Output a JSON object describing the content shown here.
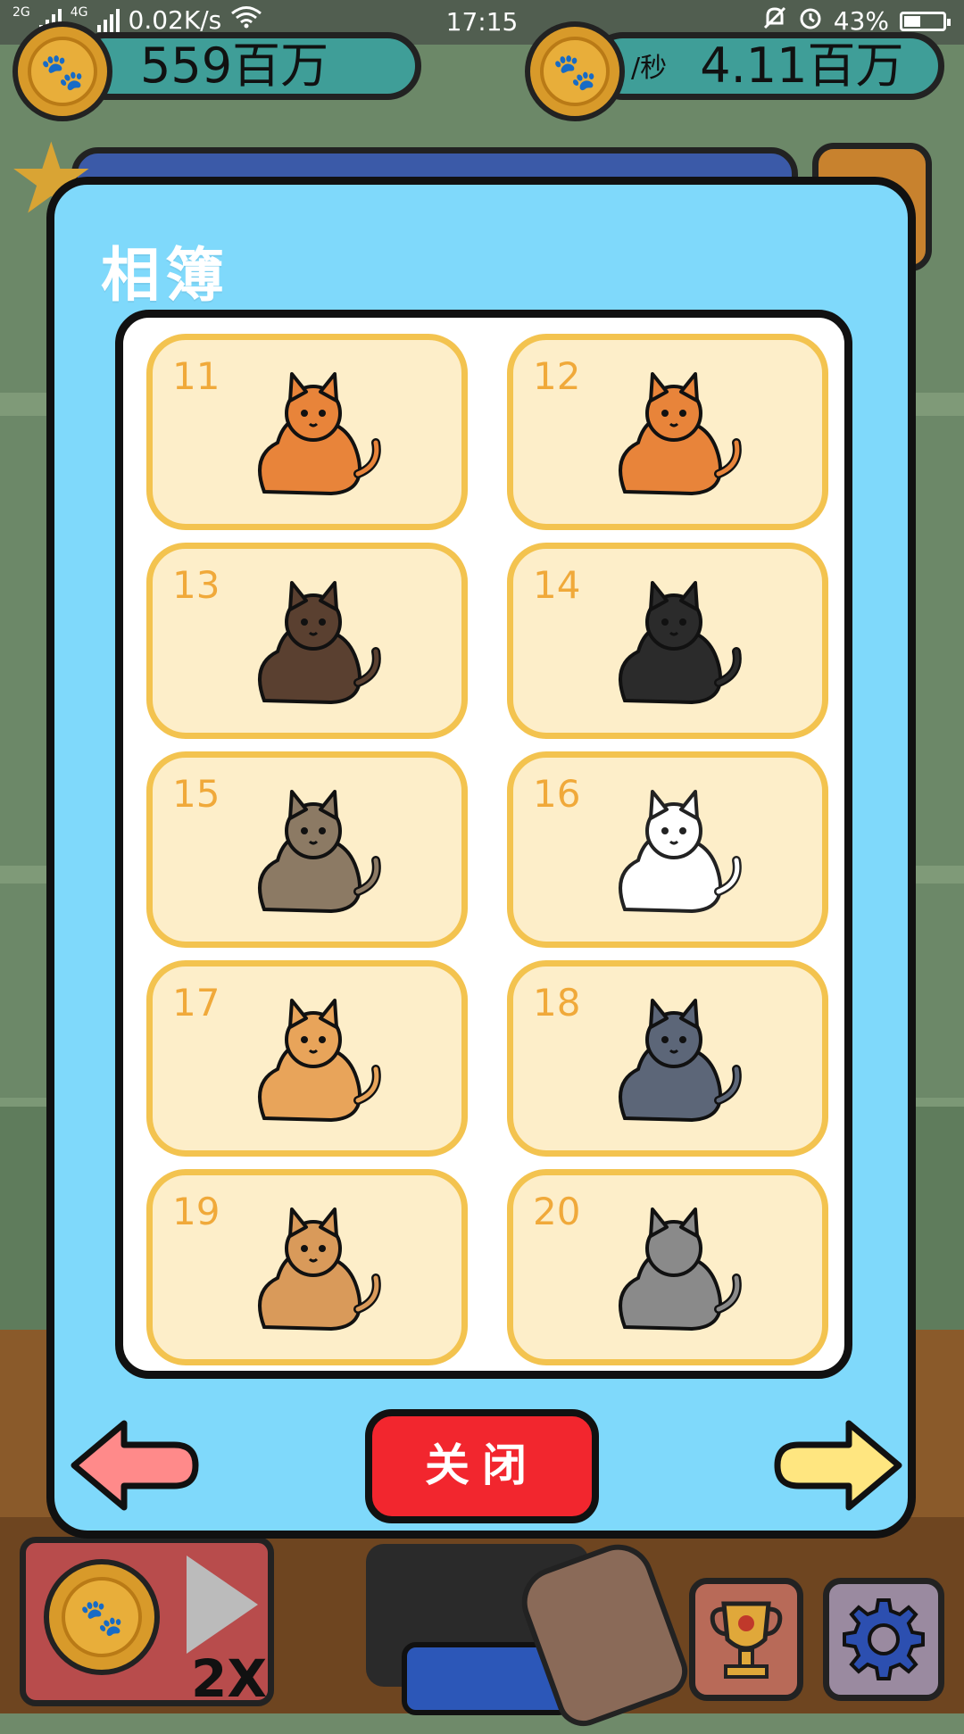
{
  "status_bar": {
    "network_1": "2G",
    "network_2": "4G",
    "speed": "0.02K/s",
    "time": "17:15",
    "battery": "43%",
    "battery_level": 0.43
  },
  "currency": {
    "total": "559百万",
    "rate_unit": "/秒",
    "rate": "4.11百万"
  },
  "album": {
    "title": "相簿",
    "slots": [
      {
        "num": "11",
        "cat": "calico-cat-icon",
        "color": "#e8843a"
      },
      {
        "num": "12",
        "cat": "orange-tabby-cat-icon",
        "color": "#e8843a"
      },
      {
        "num": "13",
        "cat": "siamese-cat-icon",
        "color": "#5a4030"
      },
      {
        "num": "14",
        "cat": "black-cat-icon",
        "color": "#2b2b2b"
      },
      {
        "num": "15",
        "cat": "grey-tabby-cat-icon",
        "color": "#8c7a64"
      },
      {
        "num": "16",
        "cat": "white-persian-cat-icon",
        "color": "#ffffff"
      },
      {
        "num": "17",
        "cat": "scottish-fold-cat-icon",
        "color": "#e8a45a"
      },
      {
        "num": "18",
        "cat": "russian-blue-cat-icon",
        "color": "#5c6678"
      },
      {
        "num": "19",
        "cat": "maine-coon-cat-icon",
        "color": "#d99a5a"
      },
      {
        "num": "20",
        "cat": "locked-cat-silhouette-icon",
        "color": "#8a8a8a"
      }
    ],
    "close_label": "关闭",
    "prev_label": "previous-page",
    "next_label": "next-page"
  },
  "hud": {
    "speed_multiplier": "2X"
  },
  "colors": {
    "modal_bg": "#7fd9fb",
    "slot_bg": "#fdeec9",
    "slot_border": "#f3c34f",
    "close_button": "#f2262e",
    "arrow_left": "#ff8a8a",
    "arrow_right": "#ffe680"
  }
}
